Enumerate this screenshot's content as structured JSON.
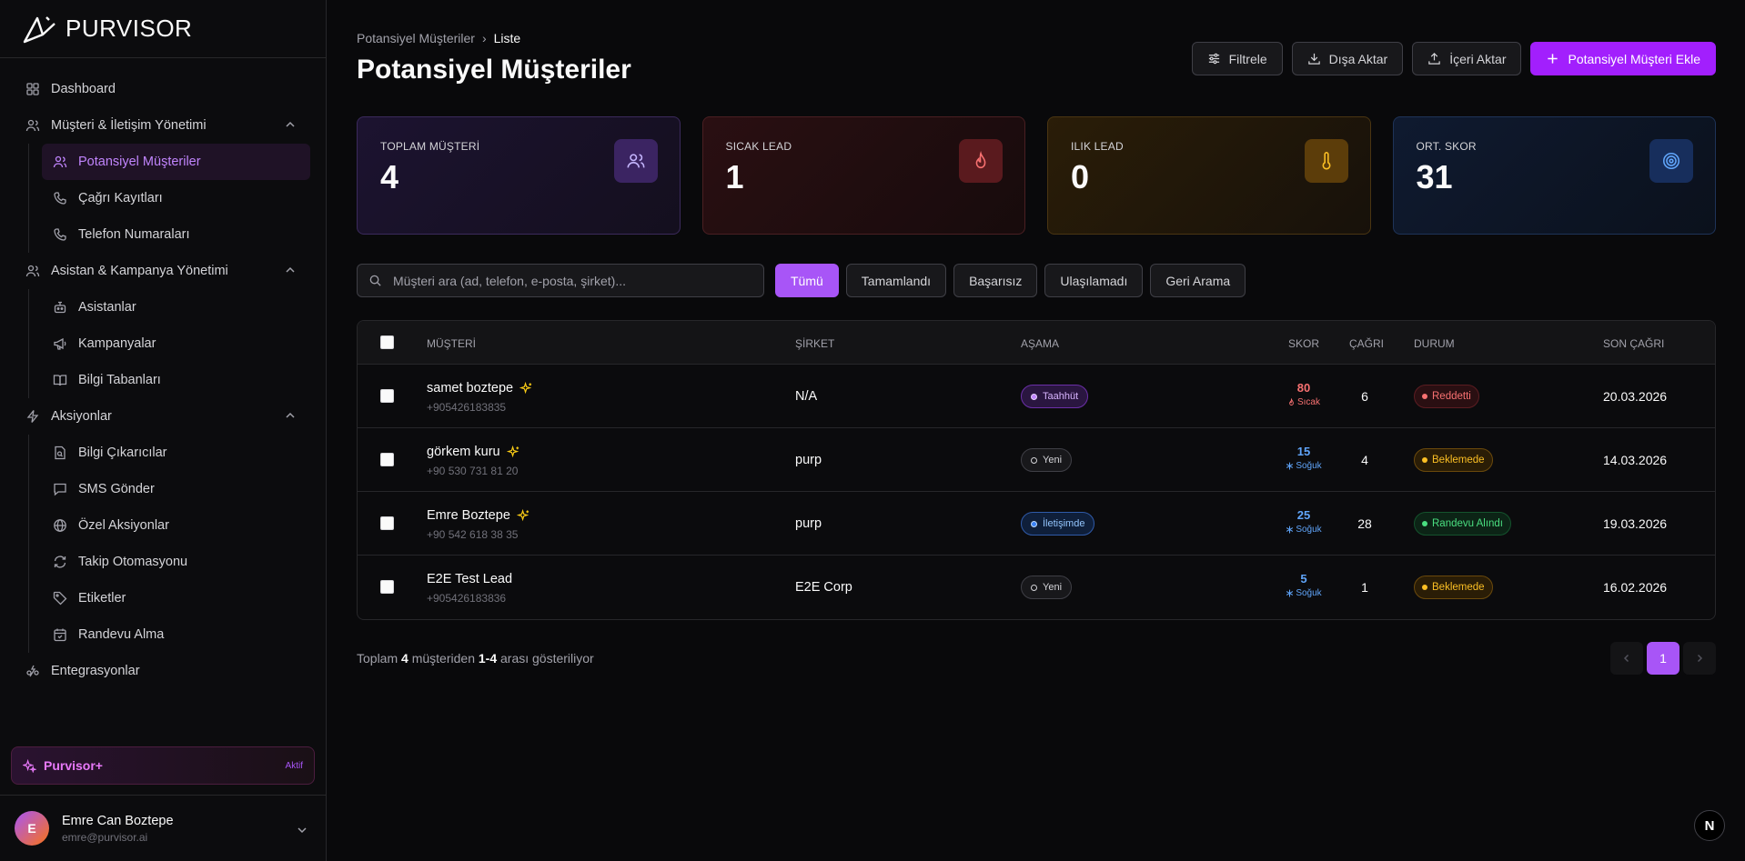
{
  "brand": {
    "name": "PURVISOR"
  },
  "sidebar": {
    "dashboard": "Dashboard",
    "group_crm": "Müşteri & İletişim Yönetimi",
    "crm_items": [
      "Potansiyel Müşteriler",
      "Çağrı Kayıtları",
      "Telefon Numaraları"
    ],
    "group_assist": "Asistan & Kampanya Yönetimi",
    "assist_items": [
      "Asistanlar",
      "Kampanyalar",
      "Bilgi Tabanları"
    ],
    "group_actions": "Aksiyonlar",
    "action_items": [
      "Bilgi Çıkarıcılar",
      "SMS Gönder",
      "Özel Aksiyonlar",
      "Takip Otomasyonu",
      "Etiketler",
      "Randevu Alma"
    ],
    "integrations": "Entegrasyonlar"
  },
  "plan": {
    "name": "Purvisor+",
    "status": "Aktif"
  },
  "user": {
    "initial": "E",
    "name": "Emre Can Boztepe",
    "email": "emre@purvisor.ai"
  },
  "breadcrumb": {
    "parent": "Potansiyel Müşteriler",
    "sep": "›",
    "current": "Liste"
  },
  "page_title": "Potansiyel Müşteriler",
  "actions": {
    "filter": "Filtrele",
    "export": "Dışa Aktar",
    "import": "İçeri Aktar",
    "add": "Potansiyel Müşteri Ekle"
  },
  "stats": [
    {
      "label": "TOPLAM MÜŞTERİ",
      "value": "4"
    },
    {
      "label": "SICAK LEAD",
      "value": "1"
    },
    {
      "label": "ILIK LEAD",
      "value": "0"
    },
    {
      "label": "ORT. SKOR",
      "value": "31"
    }
  ],
  "search": {
    "placeholder": "Müşteri ara (ad, telefon, e-posta, şirket)..."
  },
  "filter_chips": [
    "Tümü",
    "Tamamlandı",
    "Başarısız",
    "Ulaşılamadı",
    "Geri Arama"
  ],
  "table": {
    "headers": {
      "customer": "MÜŞTERİ",
      "company": "ŞİRKET",
      "stage": "AŞAMA",
      "score": "SKOR",
      "calls": "ÇAĞRI",
      "status": "DURUM",
      "last_call": "SON ÇAĞRI"
    },
    "rows": [
      {
        "name": "samet boztepe",
        "phone": "+905426183835",
        "company": "N/A",
        "stage": "Taahhüt",
        "score": "80",
        "temp": "Sıcak",
        "calls": "6",
        "status": "Reddetti",
        "last_call": "20.03.2026"
      },
      {
        "name": "görkem kuru",
        "phone": "+90 530 731 81 20",
        "company": "purp",
        "stage": "Yeni",
        "score": "15",
        "temp": "Soğuk",
        "calls": "4",
        "status": "Beklemede",
        "last_call": "14.03.2026"
      },
      {
        "name": "Emre Boztepe",
        "phone": "+90 542 618 38 35",
        "company": "purp",
        "stage": "İletişimde",
        "score": "25",
        "temp": "Soğuk",
        "calls": "28",
        "status": "Randevu Alındı",
        "last_call": "19.03.2026"
      },
      {
        "name": "E2E Test Lead",
        "phone": "+905426183836",
        "company": "E2E Corp",
        "stage": "Yeni",
        "score": "5",
        "temp": "Soğuk",
        "calls": "1",
        "status": "Beklemede",
        "last_call": "16.02.2026"
      }
    ]
  },
  "summary": {
    "prefix": "Toplam",
    "total": "4",
    "mid": "müşteriden",
    "range": "1-4",
    "suffix": "arası gösteriliyor"
  },
  "pagination": {
    "current": "1"
  },
  "corner_badge": "N",
  "colors": {
    "accent": "#a855f7",
    "primary_button": "#a21ffd",
    "hot": "#f87171",
    "cold": "#60a5fa",
    "warm": "#fbbf24",
    "success": "#4ade80"
  }
}
